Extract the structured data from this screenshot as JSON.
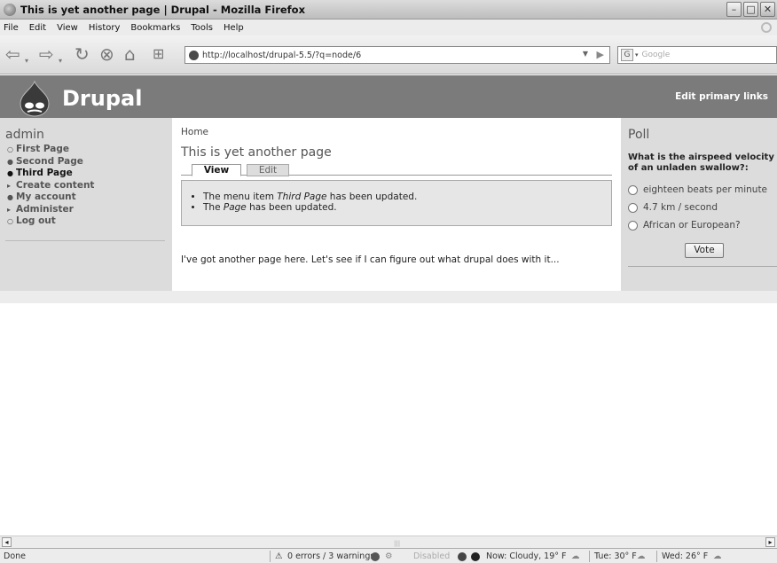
{
  "window": {
    "title": "This is yet another page | Drupal - Mozilla Firefox"
  },
  "menu": [
    "File",
    "Edit",
    "View",
    "History",
    "Bookmarks",
    "Tools",
    "Help"
  ],
  "navbar": {
    "url": "http://localhost/drupal-5.5/?q=node/6",
    "search_engine": "G",
    "search_placeholder": "Google"
  },
  "site": {
    "name": "Drupal",
    "edit_primary_links": "Edit primary links"
  },
  "user_menu": {
    "title": "admin",
    "items": [
      {
        "label": "First Page",
        "bullet": "○"
      },
      {
        "label": "Second Page",
        "bullet": "●"
      },
      {
        "label": "Third Page",
        "bullet": "●"
      },
      {
        "label": "Create content",
        "bullet": "▸"
      },
      {
        "label": "My account",
        "bullet": "●"
      },
      {
        "label": "Administer",
        "bullet": "▸"
      },
      {
        "label": "Log out",
        "bullet": "○"
      }
    ],
    "active_index": 2
  },
  "main": {
    "breadcrumb": "Home",
    "title": "This is yet another page",
    "tabs": [
      "View",
      "Edit"
    ],
    "messages": {
      "m1_pre": "The menu item ",
      "m1_em": "Third Page",
      "m1_post": " has been updated.",
      "m2_pre": "The ",
      "m2_em": "Page",
      "m2_post": " has been updated."
    },
    "body": "I've got another page here. Let's see if I can figure out what drupal does with it..."
  },
  "poll": {
    "title": "Poll",
    "question": "What is the airspeed velocity of an unladen swallow?:",
    "options": [
      "eighteen beats per minute",
      "4.7 km / second",
      "African or European?"
    ],
    "vote_label": "Vote"
  },
  "statusbar": {
    "status": "Done",
    "errors": "0 errors / 3 warnings",
    "disabled": "Disabled",
    "weather_now": "Now: Cloudy, 19° F",
    "weather_tue": "Tue: 30° F",
    "weather_wed": "Wed: 26° F"
  },
  "colors": {
    "header_bg": "#7b7b7b",
    "sidebar_bg": "#dcdcdc"
  }
}
